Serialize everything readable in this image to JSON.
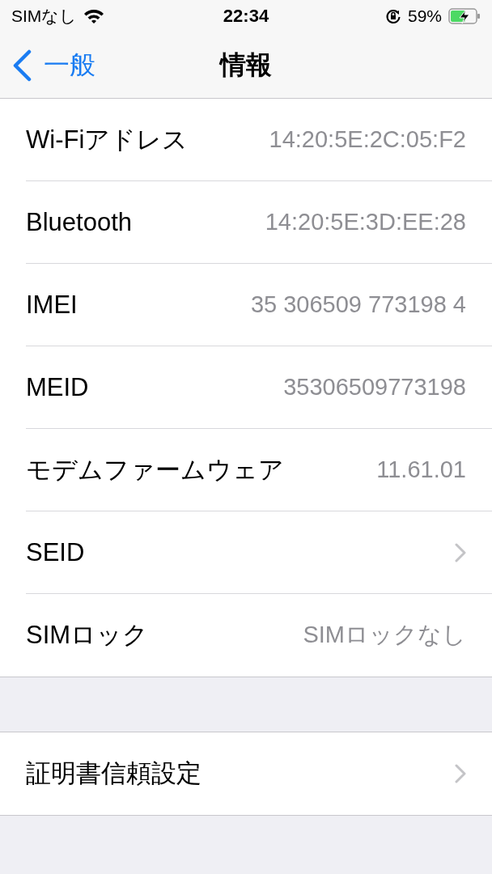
{
  "status_bar": {
    "carrier": "SIMなし",
    "time": "22:34",
    "battery_percent": "59%"
  },
  "nav_bar": {
    "back_label": "一般",
    "title": "情報"
  },
  "groups": [
    {
      "rows": [
        {
          "kind": "value",
          "label": "Wi-Fiアドレス",
          "value": "14:20:5E:2C:05:F2"
        },
        {
          "kind": "value",
          "label": "Bluetooth",
          "value": "14:20:5E:3D:EE:28"
        },
        {
          "kind": "value",
          "label": "IMEI",
          "value": "35 306509 773198 4"
        },
        {
          "kind": "value",
          "label": "MEID",
          "value": "35306509773198"
        },
        {
          "kind": "value",
          "label": "モデムファームウェア",
          "value": "11.61.01"
        },
        {
          "kind": "disclosure",
          "label": "SEID"
        },
        {
          "kind": "value",
          "label": "SIMロック",
          "value": "SIMロックなし"
        }
      ]
    },
    {
      "rows": [
        {
          "kind": "disclosure",
          "label": "証明書信頼設定"
        }
      ]
    }
  ]
}
